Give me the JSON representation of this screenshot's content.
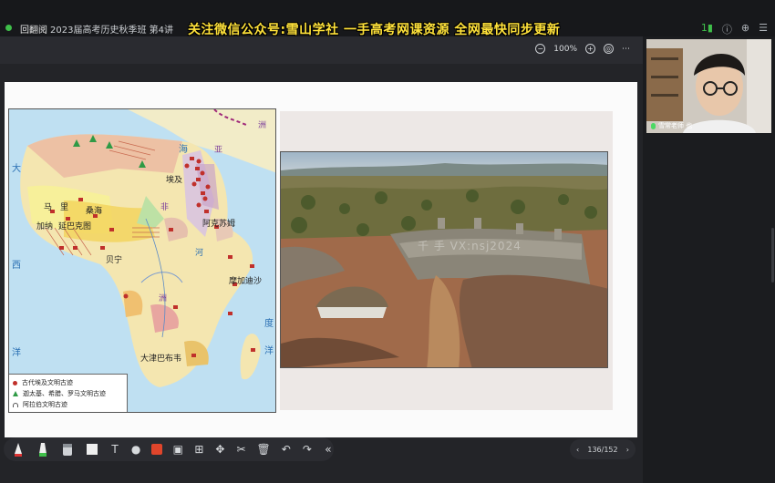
{
  "titlebar": {
    "app_name": "回翻阅",
    "class_title": "2023届高考历史秋季班 第4讲",
    "banner": "关注微信公众号:雪山学社 一手高考网课资源 全网最快同步更新",
    "signal": "1",
    "icons": [
      "signal-icon",
      "info-icon",
      "search-icon",
      "menu-icon"
    ]
  },
  "viewer": {
    "zoom_level": "100%",
    "zoom_out": "−",
    "zoom_in": "+"
  },
  "map": {
    "labels": {
      "asia": "亚",
      "continent": "洲",
      "atlantic_1": "大",
      "atlantic_2": "西",
      "atlantic_3": "洋",
      "indian_1": "度",
      "indian_2": "洋",
      "sea": "海",
      "africa_1": "非",
      "africa_2": "洲",
      "egypt": "埃及",
      "mali": "马　里",
      "songhai": "桑海",
      "ghana": "加纳",
      "kanem": "延巴克图",
      "aksum": "阿克苏姆",
      "benin": "贝宁",
      "mozambique": "摩加迪沙",
      "zimbabwe": "大津巴布韦",
      "river": "河"
    },
    "legend": [
      {
        "symbol": "dot",
        "label": "古代埃及文明古迹"
      },
      {
        "symbol": "triangle",
        "label": "迦太基、希腊、罗马文明古迹"
      },
      {
        "symbol": "arch",
        "label": "阿拉伯文明古迹"
      }
    ]
  },
  "photo": {
    "watermark": "千 手 VX:nsj2024"
  },
  "drawbar": {
    "tools": [
      "pen-icon",
      "highlighter-icon",
      "eraser-icon",
      "board-icon",
      "text-icon",
      "shape-icon",
      "color-icon",
      "image-icon",
      "plus-icon",
      "move-icon",
      "cut-icon",
      "delete-icon",
      "undo-icon",
      "redo-icon",
      "collapse-icon"
    ],
    "collapse_label": "«"
  },
  "pager": {
    "prev": "‹",
    "current": "136",
    "separator": "/",
    "total": "152",
    "next": "›"
  },
  "video": {
    "name": "雪常老师 也"
  },
  "colors": {
    "banner": "#ffe23a",
    "accent_red": "#c0302b",
    "green": "#2f9a45"
  }
}
